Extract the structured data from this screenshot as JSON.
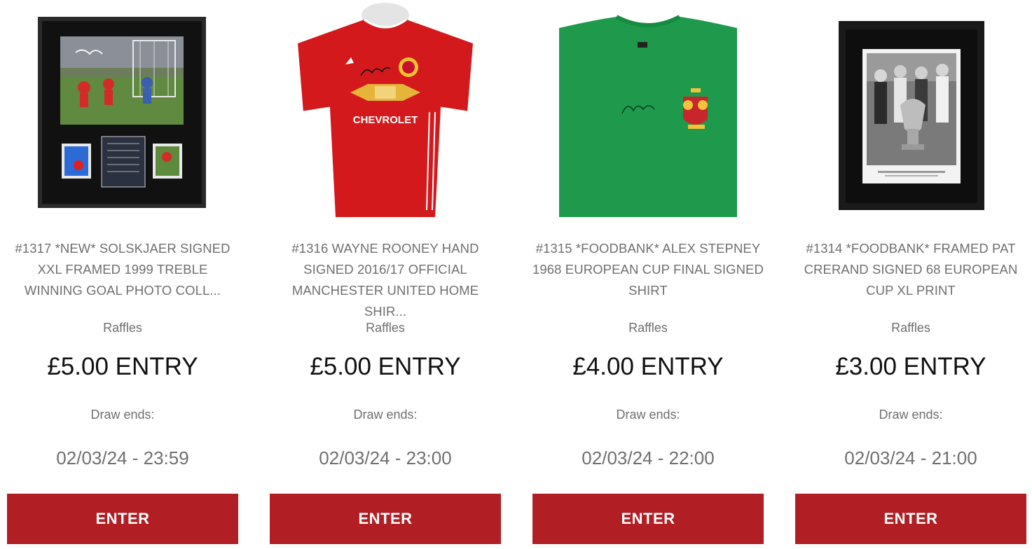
{
  "theme": {
    "accent": "#b11e24",
    "muted_text": "#6f6f6f",
    "price_text": "#111111"
  },
  "products": [
    {
      "title": "#1317 *NEW* SOLSKJAER SIGNED XXL FRAMED 1999 TREBLE WINNING GOAL PHOTO COLL...",
      "category": "Raffles",
      "price": "£5.00 ENTRY",
      "draw_label": "Draw ends:",
      "draw_date": "02/03/24 - 23:59",
      "button_label": "ENTER",
      "image": "framed-photo-collage"
    },
    {
      "title": "#1316 WAYNE ROONEY HAND SIGNED 2016/17 OFFICIAL MANCHESTER UNITED HOME SHIR...",
      "category": "Raffles",
      "price": "£5.00 ENTRY",
      "draw_label": "Draw ends:",
      "draw_date": "02/03/24 - 23:00",
      "button_label": "ENTER",
      "image": "red-home-shirt",
      "shirt_text": "CHEVROLET"
    },
    {
      "title": "#1315 *FOODBANK* ALEX STEPNEY 1968 EUROPEAN CUP FINAL SIGNED SHIRT",
      "category": "Raffles",
      "price": "£4.00 ENTRY",
      "draw_label": "Draw ends:",
      "draw_date": "02/03/24 - 22:00",
      "button_label": "ENTER",
      "image": "green-goalkeeper-shirt"
    },
    {
      "title": "#1314 *FOODBANK* FRAMED PAT CRERAND SIGNED 68 EUROPEAN CUP XL PRINT",
      "category": "Raffles",
      "price": "£3.00 ENTRY",
      "draw_label": "Draw ends:",
      "draw_date": "02/03/24 - 21:00",
      "button_label": "ENTER",
      "image": "framed-trophy-print"
    }
  ]
}
